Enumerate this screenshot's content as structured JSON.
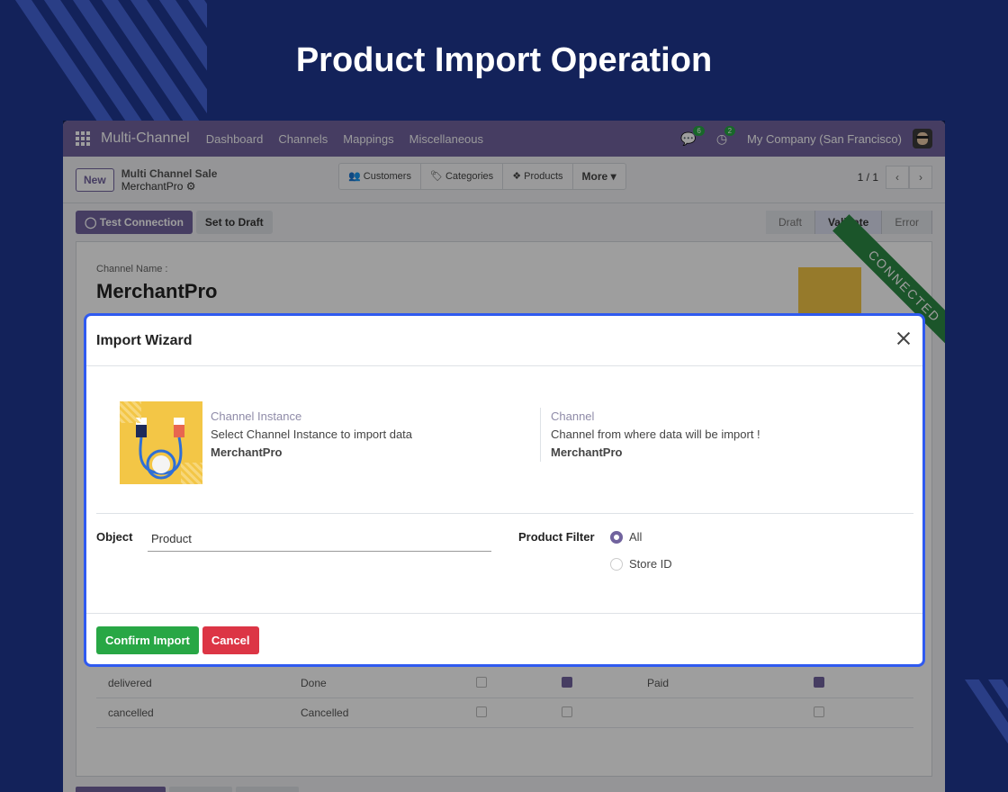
{
  "page": {
    "title": "Product Import Operation"
  },
  "navbar": {
    "brand": "Multi-Channel",
    "menus": [
      "Dashboard",
      "Channels",
      "Mappings",
      "Miscellaneous"
    ],
    "messages_count": "6",
    "activities_count": "2",
    "company": "My Company (San Francisco)"
  },
  "control_panel": {
    "new_label": "New",
    "breadcrumb_parent": "Multi Channel Sale",
    "breadcrumb_current": "MerchantPro",
    "smart_buttons": [
      "Customers",
      "Categories",
      "Products",
      "More"
    ],
    "pager": "1 / 1"
  },
  "status_bar": {
    "test_connection": "Test Connection",
    "set_to_draft": "Set to Draft",
    "stages": [
      "Draft",
      "Validate",
      "Error"
    ],
    "active_stage": "Validate"
  },
  "form": {
    "channel_name_label": "Channel Name :",
    "channel_name": "MerchantPro",
    "ribbon": "CONNECTED",
    "rows": [
      {
        "state": "delivered",
        "status": "Done",
        "chk1": false,
        "chk2": true,
        "payment": "Paid",
        "chk3": true
      },
      {
        "state": "cancelled",
        "status": "Cancelled",
        "chk1": false,
        "chk2": false,
        "payment": "",
        "chk3": false
      }
    ]
  },
  "modal": {
    "title": "Import Wizard",
    "instance": {
      "label": "Channel Instance",
      "desc": "Select Channel Instance to import data",
      "value": "MerchantPro"
    },
    "channel": {
      "label": "Channel",
      "desc": "Channel from where data will be import !",
      "value": "MerchantPro"
    },
    "object_label": "Object",
    "object_value": "Product",
    "filter_label": "Product Filter",
    "filter_options": [
      "All",
      "Store ID"
    ],
    "filter_selected": "All",
    "confirm_label": "Confirm Import",
    "cancel_label": "Cancel"
  },
  "colors": {
    "primary": "#71639e",
    "background": "#13225a",
    "modal_border": "#2f5af0",
    "confirm": "#28a745",
    "cancel": "#dc3545",
    "ribbon": "#2d8a44"
  }
}
